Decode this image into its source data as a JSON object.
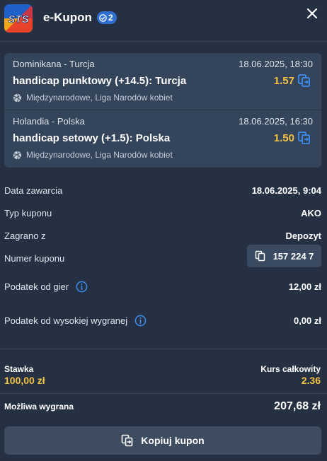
{
  "header": {
    "title": "e-Kupon",
    "badge_count": "2",
    "logo_text": "STS"
  },
  "bets": [
    {
      "match": "Dominikana - Turcja",
      "date": "18.06.2025, 18:30",
      "pick": "handicap punktowy (+14.5): Turcja",
      "odds": "1.57",
      "league": "Międzynarodowe, Liga Narodów kobiet"
    },
    {
      "match": "Holandia - Polska",
      "date": "18.06.2025, 16:30",
      "pick": "handicap setowy (+1.5): Polska",
      "odds": "1.50",
      "league": "Międzynarodowe, Liga Narodów kobiet"
    }
  ],
  "details": {
    "data_zawarcia_label": "Data zawarcia",
    "data_zawarcia_value": "18.06.2025, 9:04",
    "typ_label": "Typ kuponu",
    "typ_value": "AKO",
    "zagrano_label": "Zagrano z",
    "zagrano_value": "Depozyt",
    "numer_label": "Numer kuponu",
    "numer_value": "157 224 7",
    "podatek_gier_label": "Podatek od gier",
    "podatek_gier_value": "12,00 zł",
    "podatek_wygranej_label": "Podatek od wysokiej wygranej",
    "podatek_wygranej_value": "0,00 zł"
  },
  "summary": {
    "stawka_label": "Stawka",
    "stawka_value": "100,00 zł",
    "kurs_label": "Kurs całkowity",
    "kurs_value": "2.36",
    "wygrana_label": "Możliwa wygrana",
    "wygrana_value": "207,68 zł"
  },
  "actions": {
    "copy_label": "Kopiuj kupon"
  },
  "colors": {
    "background": "#253142",
    "card": "#34445a",
    "accent_yellow": "#f3c242",
    "badge_blue": "#2f6fcf"
  },
  "icons": {
    "close": "close-icon",
    "copy": "copy-icon",
    "info": "info-icon",
    "volleyball": "volleyball-icon"
  }
}
